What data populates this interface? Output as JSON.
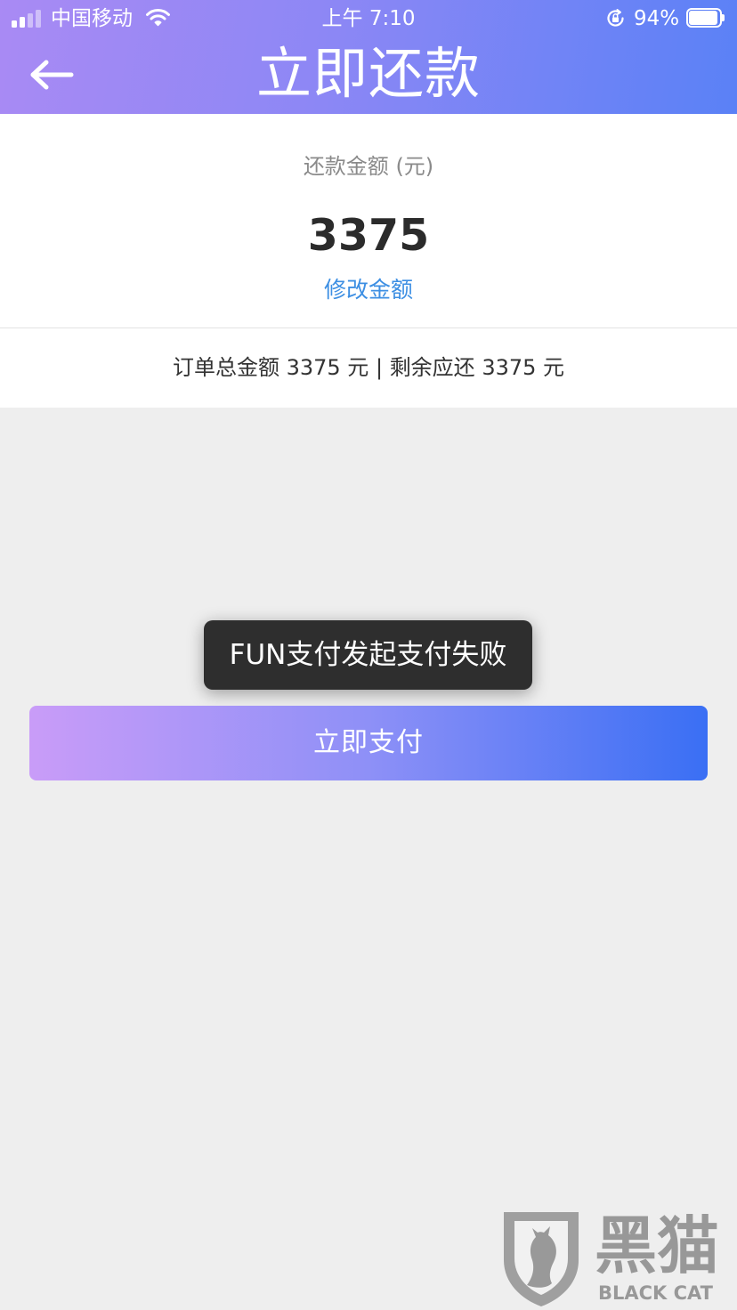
{
  "status_bar": {
    "carrier": "中国移动",
    "time": "上午 7:10",
    "battery_percent": "94%",
    "battery_level": 0.94,
    "signal_bars_active": 2,
    "signal_bars_total": 4
  },
  "header": {
    "title": "立即还款"
  },
  "repayment": {
    "label": "还款金额 (元)",
    "amount": "3375",
    "edit_label": "修改金额"
  },
  "summary": {
    "total": "订单总金额 3375 元",
    "separator": "|",
    "remaining": "剩余应还 3375 元"
  },
  "toast": {
    "message": "FUN支付发起支付失败"
  },
  "pay_button": {
    "label": "立即支付"
  },
  "watermark": {
    "brand_cn": "黑猫",
    "brand_en": "BLACK CAT"
  },
  "icons": {
    "back": "back-arrow-icon",
    "signal": "signal-icon",
    "wifi": "wifi-icon",
    "rotation_lock": "rotation-lock-icon",
    "battery": "battery-icon",
    "watermark_logo": "black-cat-shield-icon"
  },
  "colors": {
    "header_gradient_start": "#a98af4",
    "header_gradient_end": "#5a81f6",
    "button_gradient_start": "#c99cf8",
    "button_gradient_end": "#3a6ff4",
    "link": "#3d8fe3",
    "background": "#eeeeee",
    "toast_bg": "#2e2e2e"
  }
}
